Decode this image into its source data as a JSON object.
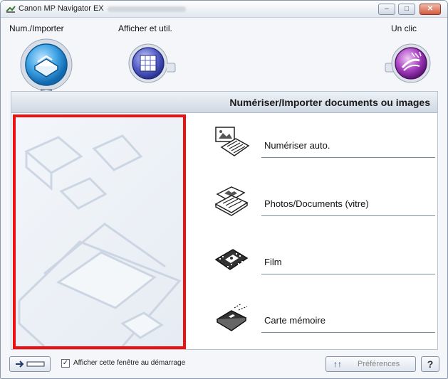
{
  "window": {
    "title": "Canon MP Navigator EX",
    "minimize_glyph": "–",
    "maximize_glyph": "□",
    "close_glyph": "✕"
  },
  "modes": [
    {
      "label": "Num./Importer",
      "icon": "scanner-icon"
    },
    {
      "label": "Afficher et util.",
      "icon": "grid-view-icon"
    },
    {
      "label": "Un clic",
      "icon": "one-click-icon"
    }
  ],
  "panel": {
    "title": "Numériser/Importer documents ou images",
    "actions": [
      {
        "label": "Numériser auto.",
        "icon": "auto-scan-icon"
      },
      {
        "label": "Photos/Documents (vitre)",
        "icon": "photos-documents-icon"
      },
      {
        "label": "Film",
        "icon": "film-icon"
      },
      {
        "label": "Carte mémoire",
        "icon": "memory-card-icon"
      }
    ]
  },
  "footer": {
    "show_window_label": "Afficher cette fenêtre au démarrage",
    "show_window_checked": true,
    "preferences_label": "Préférences",
    "help_label": "?",
    "toggle_icon": "switch-view-icon"
  },
  "colors": {
    "highlight_border": "#ee1111",
    "accent_blue": "#2a8fd6",
    "accent_purple": "#8a2ea8"
  }
}
